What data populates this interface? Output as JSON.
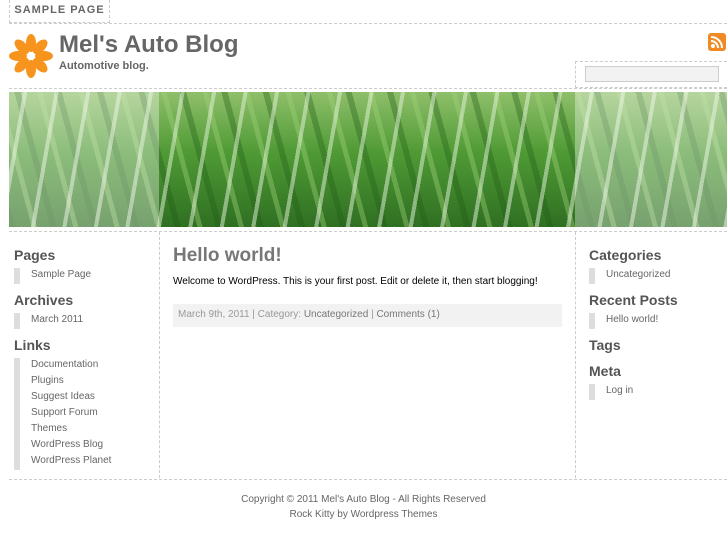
{
  "nav": {
    "sample_page": "SAMPLE PAGE"
  },
  "header": {
    "title": "Mel's Auto Blog",
    "tagline": "Automotive blog.",
    "search_placeholder": ""
  },
  "left_sidebar": {
    "pages_title": "Pages",
    "pages": [
      "Sample Page"
    ],
    "archives_title": "Archives",
    "archives": [
      "March 2011"
    ],
    "links_title": "Links",
    "links": [
      "Documentation",
      "Plugins",
      "Suggest Ideas",
      "Support Forum",
      "Themes",
      "WordPress Blog",
      "WordPress Planet"
    ]
  },
  "post": {
    "title": "Hello world!",
    "body": "Welcome to WordPress. This is your first post. Edit or delete it, then start blogging!",
    "date": "March 9th, 2011 | Category: ",
    "category": "Uncategorized",
    "sep": " | ",
    "comments": "Comments (1)"
  },
  "right_sidebar": {
    "categories_title": "Categories",
    "categories": [
      "Uncategorized"
    ],
    "recent_title": "Recent Posts",
    "recent": [
      "Hello world!"
    ],
    "tags_title": "Tags",
    "meta_title": "Meta",
    "meta": [
      "Log in"
    ]
  },
  "footer": {
    "copyright": "Copyright © 2011 Mel's Auto Blog - All Rights Reserved",
    "credit": "Rock Kitty by Wordpress Themes"
  },
  "colors": {
    "logo": "#f7941d",
    "rss": "#f08a24"
  }
}
